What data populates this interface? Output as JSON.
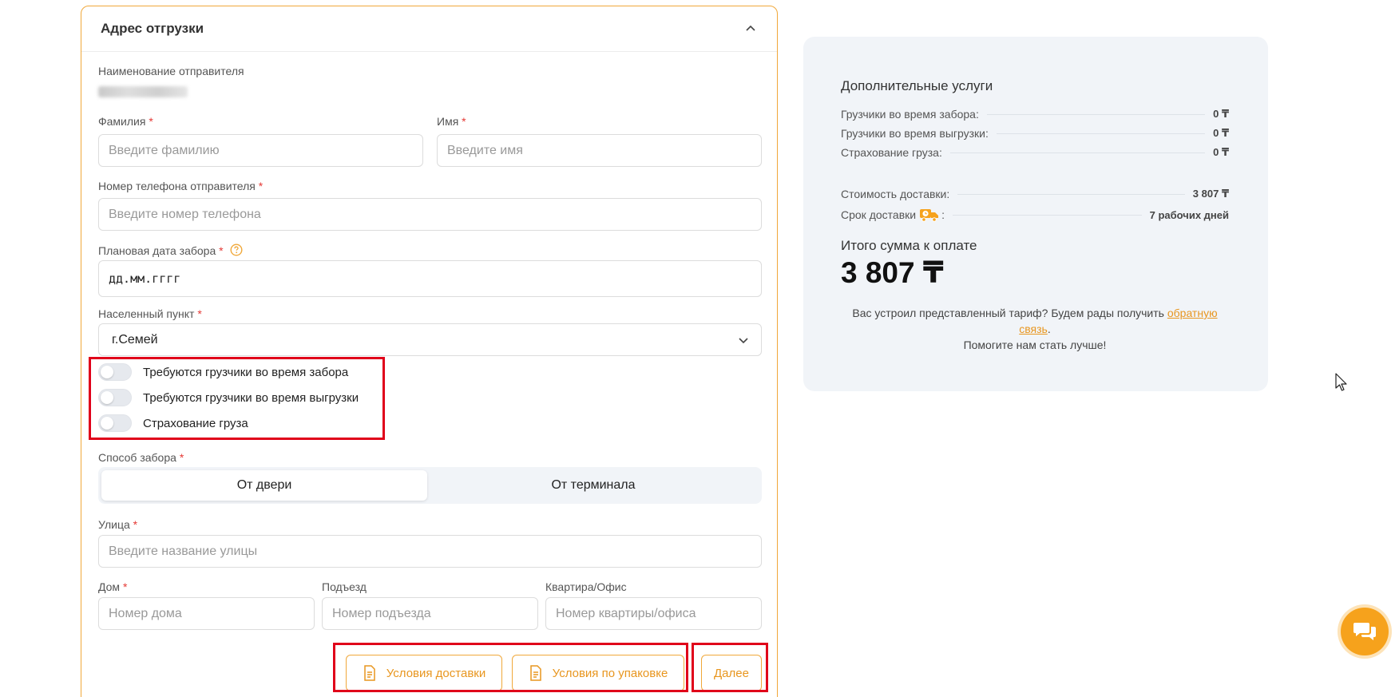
{
  "form": {
    "header_title": "Адрес отгрузки",
    "sender_label": "Наименование отправителя",
    "lastname": {
      "label": "Фамилия",
      "placeholder": "Введите фамилию"
    },
    "firstname": {
      "label": "Имя",
      "placeholder": "Введите имя"
    },
    "phone": {
      "label": "Номер телефона отправителя",
      "placeholder": "Введите номер телефона"
    },
    "date": {
      "label": "Плановая дата забора",
      "value": "дд.мм.гггг"
    },
    "city": {
      "label": "Населенный пункт",
      "value": "г.Семей"
    },
    "required_mark": "*",
    "toggles": [
      {
        "label": "Требуются грузчики во время забора"
      },
      {
        "label": "Требуются грузчики во время выгрузки"
      },
      {
        "label": "Страхование груза"
      }
    ],
    "pickup_method": {
      "label": "Способ забора",
      "options": [
        "От двери",
        "От терминала"
      ]
    },
    "street": {
      "label": "Улица",
      "placeholder": "Введите название улицы"
    },
    "house": {
      "label": "Дом",
      "placeholder": "Номер дома"
    },
    "entrance": {
      "label": "Подъезд",
      "placeholder": "Номер подъезда"
    },
    "apartment": {
      "label": "Квартира/Офис",
      "placeholder": "Номер квартиры/офиса"
    },
    "buttons": {
      "delivery_terms": "Условия доставки",
      "packing_terms": "Условия по упаковке",
      "next": "Далее"
    }
  },
  "summary": {
    "title": "Дополнительные услуги",
    "services": [
      {
        "label": "Грузчики во время забора:",
        "value": "0 ₸"
      },
      {
        "label": "Грузчики во время выгрузки:",
        "value": "0 ₸"
      },
      {
        "label": "Страхование груза:",
        "value": "0 ₸"
      }
    ],
    "delivery_cost": {
      "label": "Стоимость доставки:",
      "value": "3 807 ₸"
    },
    "delivery_time": {
      "label": "Срок доставки",
      "colon": ":",
      "value": "7 рабочих дней"
    },
    "total_label": "Итого сумма к оплате",
    "total_value": "3 807 ₸",
    "feedback_text": "Вас устроил представленный тариф? Будем рады получить ",
    "feedback_link": "обратную связь",
    "feedback_end": ".",
    "feedback_line2": "Помогите нам стать лучше!"
  },
  "colors": {
    "accent": "#f6a21c",
    "highlight_border": "#e0001a",
    "summary_bg": "#f1f4f8"
  }
}
